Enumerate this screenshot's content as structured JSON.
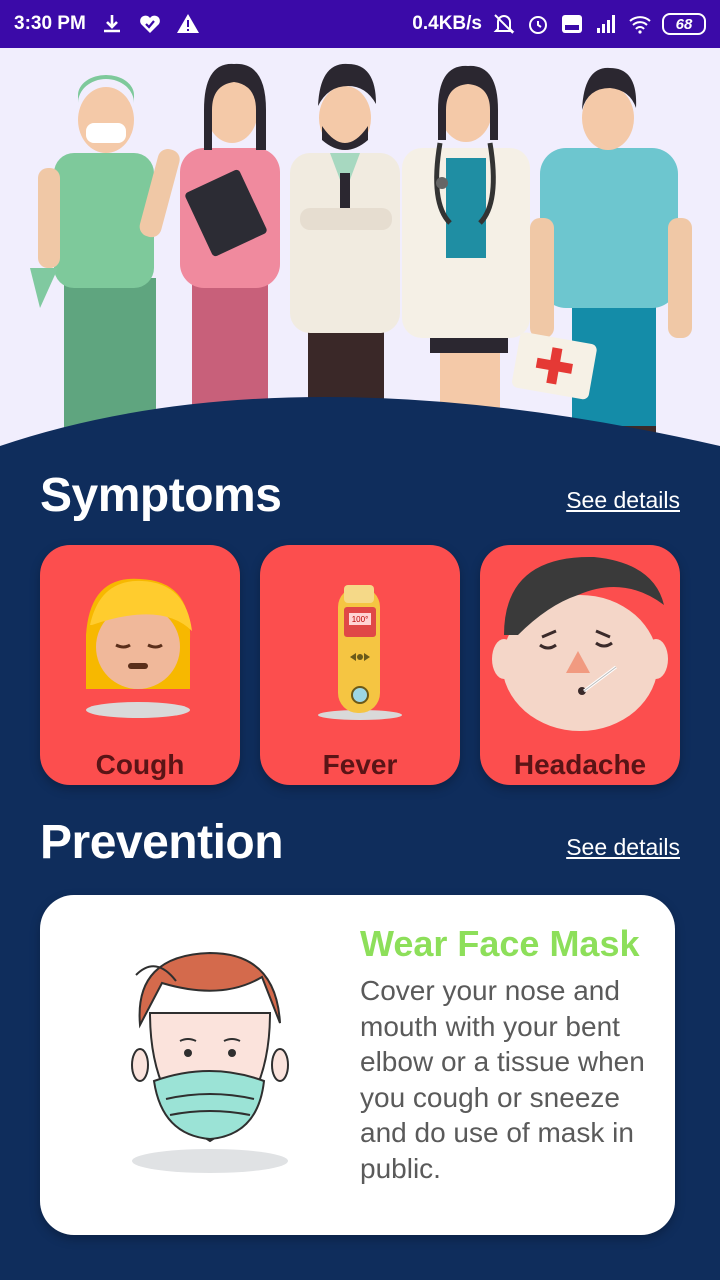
{
  "status_bar": {
    "time": "3:30 PM",
    "net_speed": "0.4KB/s",
    "battery": "68",
    "icons": [
      "download-icon",
      "heart-check-icon",
      "warning-icon",
      "mute-icon",
      "alarm-icon",
      "volte-icon",
      "signal-icon",
      "wifi-icon",
      "battery-icon"
    ]
  },
  "symptoms": {
    "title": "Symptoms",
    "see_details": "See details",
    "items": [
      {
        "label": "Cough",
        "icon": "coughing-girl-icon"
      },
      {
        "label": "Fever",
        "icon": "thermometer-icon"
      },
      {
        "label": "Headache",
        "icon": "sick-boy-icon"
      }
    ]
  },
  "prevention": {
    "title": "Prevention",
    "see_details": "See details",
    "card": {
      "title": "Wear Face Mask",
      "text": "Cover your nose and mouth with your bent elbow or a tissue when you cough or sneeze and do use of mask in public.",
      "icon": "masked-man-icon"
    }
  },
  "colors": {
    "status_bar": "#3b0aa8",
    "background": "#0f2d5c",
    "hero": "#f1eefd",
    "symptom_card": "#fc4e4e",
    "symptom_label": "#5a1416",
    "prevention_title": "#8ddf5a"
  }
}
